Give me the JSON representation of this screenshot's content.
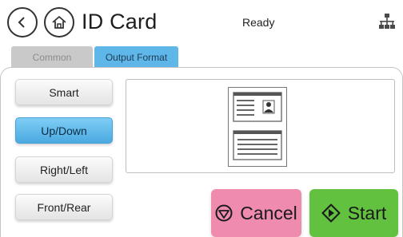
{
  "header": {
    "title": "ID Card",
    "status": "Ready",
    "back_icon": "chevron-left-icon",
    "home_icon": "home-icon",
    "network_icon": "network-icon"
  },
  "tabs": [
    {
      "label": "Common",
      "active": false
    },
    {
      "label": "Output Format",
      "active": true
    }
  ],
  "options": [
    {
      "label": "Smart",
      "selected": false
    },
    {
      "label": "Up/Down",
      "selected": true
    },
    {
      "label": "Right/Left",
      "selected": false
    },
    {
      "label": "Front/Rear",
      "selected": false
    }
  ],
  "actions": {
    "cancel_label": "Cancel",
    "start_label": "Start"
  },
  "colors": {
    "accent": "#5fb6e8",
    "cancel": "#f08bb0",
    "start": "#62c23f"
  }
}
